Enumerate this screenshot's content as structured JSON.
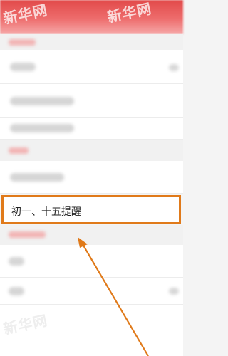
{
  "watermark": "新华网",
  "highlighted_item": {
    "label": "初一、十五提醒"
  },
  "colors": {
    "header": "#e24a4a",
    "annotation": "#e07a1a"
  },
  "icons": {
    "arrow": "annotation-arrow-icon"
  }
}
